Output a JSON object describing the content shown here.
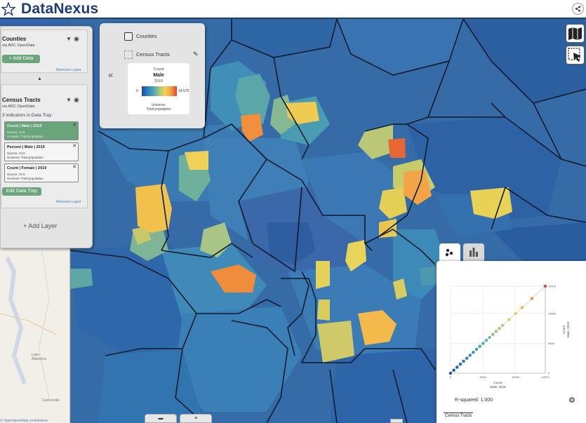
{
  "app": {
    "title": "DataNexus"
  },
  "layers": {
    "counties": {
      "title": "Counties",
      "source": "via ARC OpenData",
      "add_data_label": "+ Add Data",
      "remove_label": "Remove Layer"
    },
    "tracts": {
      "title": "Census Tracts",
      "source": "via ARC OpenData",
      "indicators_heading": "3 indicators in Data Tray:",
      "indicators": [
        {
          "title": "Count | Male | 2019",
          "source": "Source: ACS",
          "universe": "Universe: Total population"
        },
        {
          "title": "Percent | Male | 2019",
          "source": "Source: ACS",
          "universe": "Universe: Total population"
        },
        {
          "title": "Count | Female | 2019",
          "source": "Source: ACS",
          "universe": "Universe: Total population"
        }
      ],
      "edit_tray_label": "Edit Data Tray",
      "remove_label": "Remove Layer"
    },
    "add_layer_label": "+ Add Layer"
  },
  "legend": {
    "counties_label": "Counties",
    "tracts_label": "Census Tracts",
    "card": {
      "measure": "Count",
      "variable": "Male",
      "year": "2019",
      "min": "0",
      "max": "14,570",
      "universe_label": "Universe:",
      "universe_value": "Total population"
    }
  },
  "map": {
    "osm_labels": [
      "Lake",
      "Allatoona",
      "Cartersville"
    ],
    "bottom_left_text": "© OpenStreetMap contributors"
  },
  "scatter": {
    "r_squared": "R-squared: 1.000",
    "tab_label": "Census Tracts",
    "chart_data": {
      "type": "scatter",
      "x": [
        0,
        500,
        1000,
        1500,
        2000,
        2500,
        3000,
        3500,
        4000,
        4500,
        5000,
        5500,
        6000,
        6500,
        7000,
        7500,
        8000,
        9000,
        10000,
        11000,
        12500,
        14570
      ],
      "y": [
        0,
        500,
        1000,
        1500,
        2000,
        2500,
        3000,
        3500,
        4000,
        4500,
        5000,
        5500,
        6000,
        6500,
        7000,
        7500,
        8000,
        9000,
        10000,
        11000,
        12500,
        14570
      ],
      "x_ticks": [
        "0",
        "5000",
        "10000",
        "14570"
      ],
      "y_ticks": [
        "0",
        "5000",
        "10000",
        "14570"
      ],
      "xlabel": "Count\nMale, 2019",
      "ylabel": "Count\nMale, 2019",
      "xlim": [
        0,
        14570
      ],
      "ylim": [
        0,
        14570
      ]
    }
  },
  "bottom_tabs": [
    "▬",
    "≡"
  ],
  "colors": {
    "brand": "#1d3c78",
    "green": "#6aa57b",
    "map_blue": "#2f5f9e",
    "scale_low": "#1a4aa8",
    "scale_high": "#e5402a"
  }
}
